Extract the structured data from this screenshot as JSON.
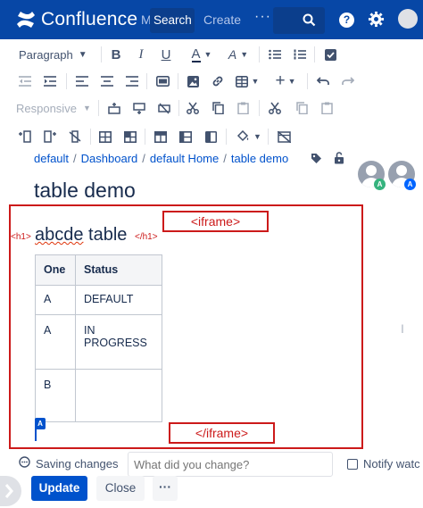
{
  "topbar": {
    "app_name": "Confluence",
    "nav_partial": "M",
    "search_label": "Search",
    "create_label": "Create",
    "more_label": "···",
    "help_label": "?"
  },
  "toolbar": {
    "paragraph_label": "Paragraph",
    "responsive_label": "Responsive",
    "bold": "B",
    "italic": "I",
    "underline": "U",
    "text_color": "A",
    "more_formatting": "A"
  },
  "breadcrumb": {
    "items": [
      "default",
      "Dashboard",
      "default Home",
      "table demo"
    ],
    "separator": "/"
  },
  "collaborators": [
    {
      "badge": "A",
      "badge_color": "#36b37e"
    },
    {
      "badge": "A",
      "badge_color": "#0065ff"
    }
  ],
  "page": {
    "title": "table demo"
  },
  "content": {
    "annotation_open": "<iframe>",
    "annotation_close": "</iframe>",
    "h1_open_tag": "<h1>",
    "h1_close_tag": "</h1>",
    "heading_word1": "abcde",
    "heading_word2": " table",
    "cursor_badge": "A",
    "table": {
      "headers": [
        "One",
        "Status"
      ],
      "rows": [
        [
          "A",
          "DEFAULT"
        ],
        [
          "A",
          "IN PROGRESS"
        ],
        [
          "B",
          ""
        ]
      ]
    }
  },
  "footer": {
    "saving_status": "Saving changes",
    "change_placeholder": "What did you change?",
    "notify_label": "Notify watc",
    "update_label": "Update",
    "close_label": "Close",
    "more_label": "···"
  },
  "colors": {
    "header_bg": "#0747a6",
    "primary": "#0052cc",
    "annotation_red": "#cc1a1a"
  }
}
